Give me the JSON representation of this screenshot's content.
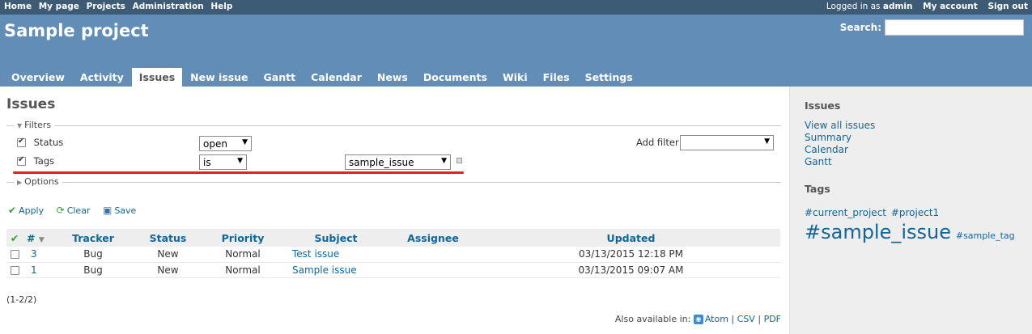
{
  "top_menu": {
    "items": [
      "Home",
      "My page",
      "Projects",
      "Administration",
      "Help"
    ],
    "logged_as_prefix": "Logged in as",
    "logged_user": "admin",
    "my_account": "My account",
    "sign_out": "Sign out"
  },
  "header": {
    "project_title": "Sample project",
    "search_label": "Search:",
    "search_value": ""
  },
  "main_menu": {
    "tabs": [
      "Overview",
      "Activity",
      "Issues",
      "New issue",
      "Gantt",
      "Calendar",
      "News",
      "Documents",
      "Wiki",
      "Files",
      "Settings"
    ],
    "selected": "Issues"
  },
  "content": {
    "title": "Issues",
    "filters_legend": "Filters",
    "options_legend": "Options",
    "filters": [
      {
        "label": "Status",
        "checked": true,
        "operator": "open"
      },
      {
        "label": "Tags",
        "checked": true,
        "operator": "is",
        "value": "sample_issue"
      }
    ],
    "add_filter_label": "Add filter",
    "add_filter_value": "",
    "actions": {
      "apply": "Apply",
      "clear": "Clear",
      "save": "Save"
    },
    "table": {
      "headers": [
        "#",
        "Tracker",
        "Status",
        "Priority",
        "Subject",
        "Assignee",
        "Updated"
      ],
      "rows": [
        {
          "id": "3",
          "tracker": "Bug",
          "status": "New",
          "priority": "Normal",
          "subject": "Test issue",
          "assignee": "",
          "updated": "03/13/2015 12:18 PM"
        },
        {
          "id": "1",
          "tracker": "Bug",
          "status": "New",
          "priority": "Normal",
          "subject": "Sample issue",
          "assignee": "",
          "updated": "03/13/2015 09:07 AM"
        }
      ]
    },
    "count": "(1-2/2)",
    "export": {
      "label": "Also available in:",
      "atom": "Atom",
      "csv": "CSV",
      "pdf": "PDF",
      "sep": "|"
    }
  },
  "sidebar": {
    "issues_heading": "Issues",
    "links": [
      "View all issues",
      "Summary",
      "Calendar",
      "Gantt"
    ],
    "tags_heading": "Tags",
    "tags": [
      "#current_project",
      "#project1",
      "#sample_issue",
      "#sample_tag"
    ]
  },
  "colors": {
    "top_menu_bg": "#3e5b76",
    "header_bg": "#628db6",
    "link": "#169",
    "highlight_underline": "#e2202a",
    "sidebar_bg": "#eeeeee"
  },
  "icons": {
    "apply": "checkmark-icon",
    "clear": "refresh-icon",
    "save": "floppy-disk-icon",
    "atom": "feed-icon"
  }
}
